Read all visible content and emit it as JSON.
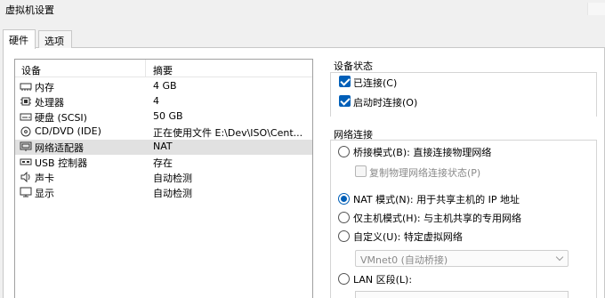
{
  "window": {
    "title": "虚拟机设置"
  },
  "tabs": [
    {
      "label": "硬件"
    },
    {
      "label": "选项"
    }
  ],
  "device_list": {
    "col_device": "设备",
    "col_summary": "摘要",
    "rows": [
      {
        "icon": "memory-icon",
        "name": "内存",
        "summary": "4 GB"
      },
      {
        "icon": "cpu-icon",
        "name": "处理器",
        "summary": "4"
      },
      {
        "icon": "harddisk-icon",
        "name": "硬盘 (SCSI)",
        "summary": "50 GB"
      },
      {
        "icon": "cdrom-icon",
        "name": "CD/DVD (IDE)",
        "summary": "正在使用文件 E:\\Dev\\ISO\\Cent..."
      },
      {
        "icon": "network-adapter-icon",
        "name": "网络适配器",
        "summary": "NAT",
        "selected": true
      },
      {
        "icon": "usb-icon",
        "name": "USB 控制器",
        "summary": "存在"
      },
      {
        "icon": "speaker-icon",
        "name": "声卡",
        "summary": "自动检测"
      },
      {
        "icon": "monitor-icon",
        "name": "显示",
        "summary": "自动检测"
      }
    ]
  },
  "device_status": {
    "title": "设备状态",
    "connected": {
      "label": "已连接(C)",
      "checked": true
    },
    "connect_at_power_on": {
      "label": "启动时连接(O)",
      "checked": true
    }
  },
  "network": {
    "title": "网络连接",
    "bridged": {
      "label": "桥接模式(B): 直接连接物理网络",
      "selected": false
    },
    "replicate": {
      "label": "复制物理网络连接状态(P)",
      "checked": false
    },
    "nat": {
      "label": "NAT 模式(N): 用于共享主机的 IP 地址",
      "selected": true
    },
    "host_only": {
      "label": "仅主机模式(H): 与主机共享的专用网络",
      "selected": false
    },
    "custom": {
      "label": "自定义(U): 特定虚拟网络",
      "selected": false
    },
    "custom_select": {
      "value": "VMnet0 (自动桥接)"
    },
    "lan": {
      "label": "LAN 区段(L):",
      "selected": false
    }
  },
  "colors": {
    "accent": "#005fb8",
    "selection": "#e1e1e1"
  }
}
